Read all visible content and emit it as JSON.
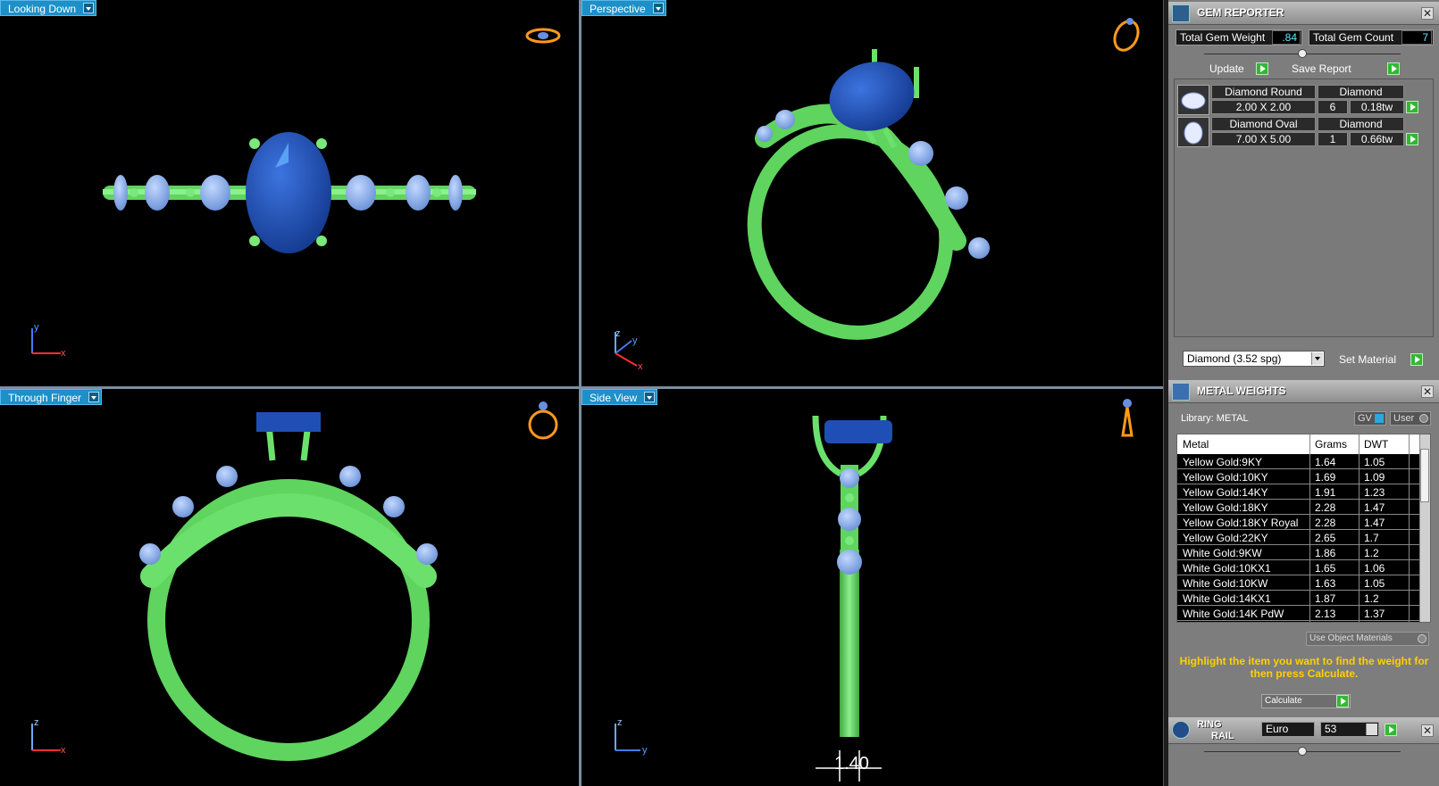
{
  "viewports": {
    "top_left": "Looking Down",
    "top_right": "Perspective",
    "bottom_left": "Through Finger",
    "bottom_right": "Side View"
  },
  "axes": {
    "top_left": [
      "y",
      "x"
    ],
    "top_right": [
      "z",
      "y",
      "x"
    ],
    "bottom_left": [
      "z",
      "x"
    ],
    "bottom_right": [
      "z",
      "y"
    ]
  },
  "side_view_dimension": "1.40",
  "gem_reporter": {
    "title": "GEM REPORTER",
    "total_weight_label": "Total Gem Weight",
    "total_weight_value": ".84",
    "total_count_label": "Total Gem Count",
    "total_count_value": "7",
    "update_label": "Update",
    "save_report_label": "Save Report",
    "gems": [
      {
        "name": "Diamond Round",
        "material": "Diamond",
        "size": "2.00 X 2.00",
        "count": "6",
        "weight": "0.18tw"
      },
      {
        "name": "Diamond Oval",
        "material": "Diamond",
        "size": "7.00 X 5.00",
        "count": "1",
        "weight": "0.66tw"
      }
    ],
    "material_select": "Diamond    (3.52 spg)",
    "set_material_label": "Set Material"
  },
  "metal_weights": {
    "title": "METAL WEIGHTS",
    "library_label": "Library: METAL",
    "gv_label": "GV",
    "user_label": "User",
    "columns": [
      "Metal",
      "Grams",
      "DWT"
    ],
    "rows": [
      [
        "Yellow Gold:9KY",
        "1.64",
        "1.05"
      ],
      [
        "Yellow Gold:10KY",
        "1.69",
        "1.09"
      ],
      [
        "Yellow Gold:14KY",
        "1.91",
        "1.23"
      ],
      [
        "Yellow Gold:18KY",
        "2.28",
        "1.47"
      ],
      [
        "Yellow Gold:18KY Royal",
        "2.28",
        "1.47"
      ],
      [
        "Yellow Gold:22KY",
        "2.65",
        "1.7"
      ],
      [
        "White Gold:9KW",
        "1.86",
        "1.2"
      ],
      [
        "White Gold:10KX1",
        "1.65",
        "1.06"
      ],
      [
        "White Gold:10KW",
        "1.63",
        "1.05"
      ],
      [
        "White Gold:14KX1",
        "1.87",
        "1.2"
      ],
      [
        "White Gold:14K PdW",
        "2.13",
        "1.37"
      ]
    ],
    "use_object_materials_label": "Use Object Materials",
    "hint": "Highlight the item you want to find the weight for then press Calculate.",
    "calculate_label": "Calculate"
  },
  "ring_rail": {
    "title_line1": "RING",
    "title_line2": "RAIL",
    "standard": "Euro",
    "size": "53"
  },
  "colors": {
    "metal_green": "#6ce06c",
    "center_stone_blue": "#1f4fb5",
    "side_stone_blue": "#8fb4ee",
    "viewport_tab": "#1e90c8",
    "hint_yellow": "#ffd000",
    "value_cyan": "#62e3ff"
  }
}
